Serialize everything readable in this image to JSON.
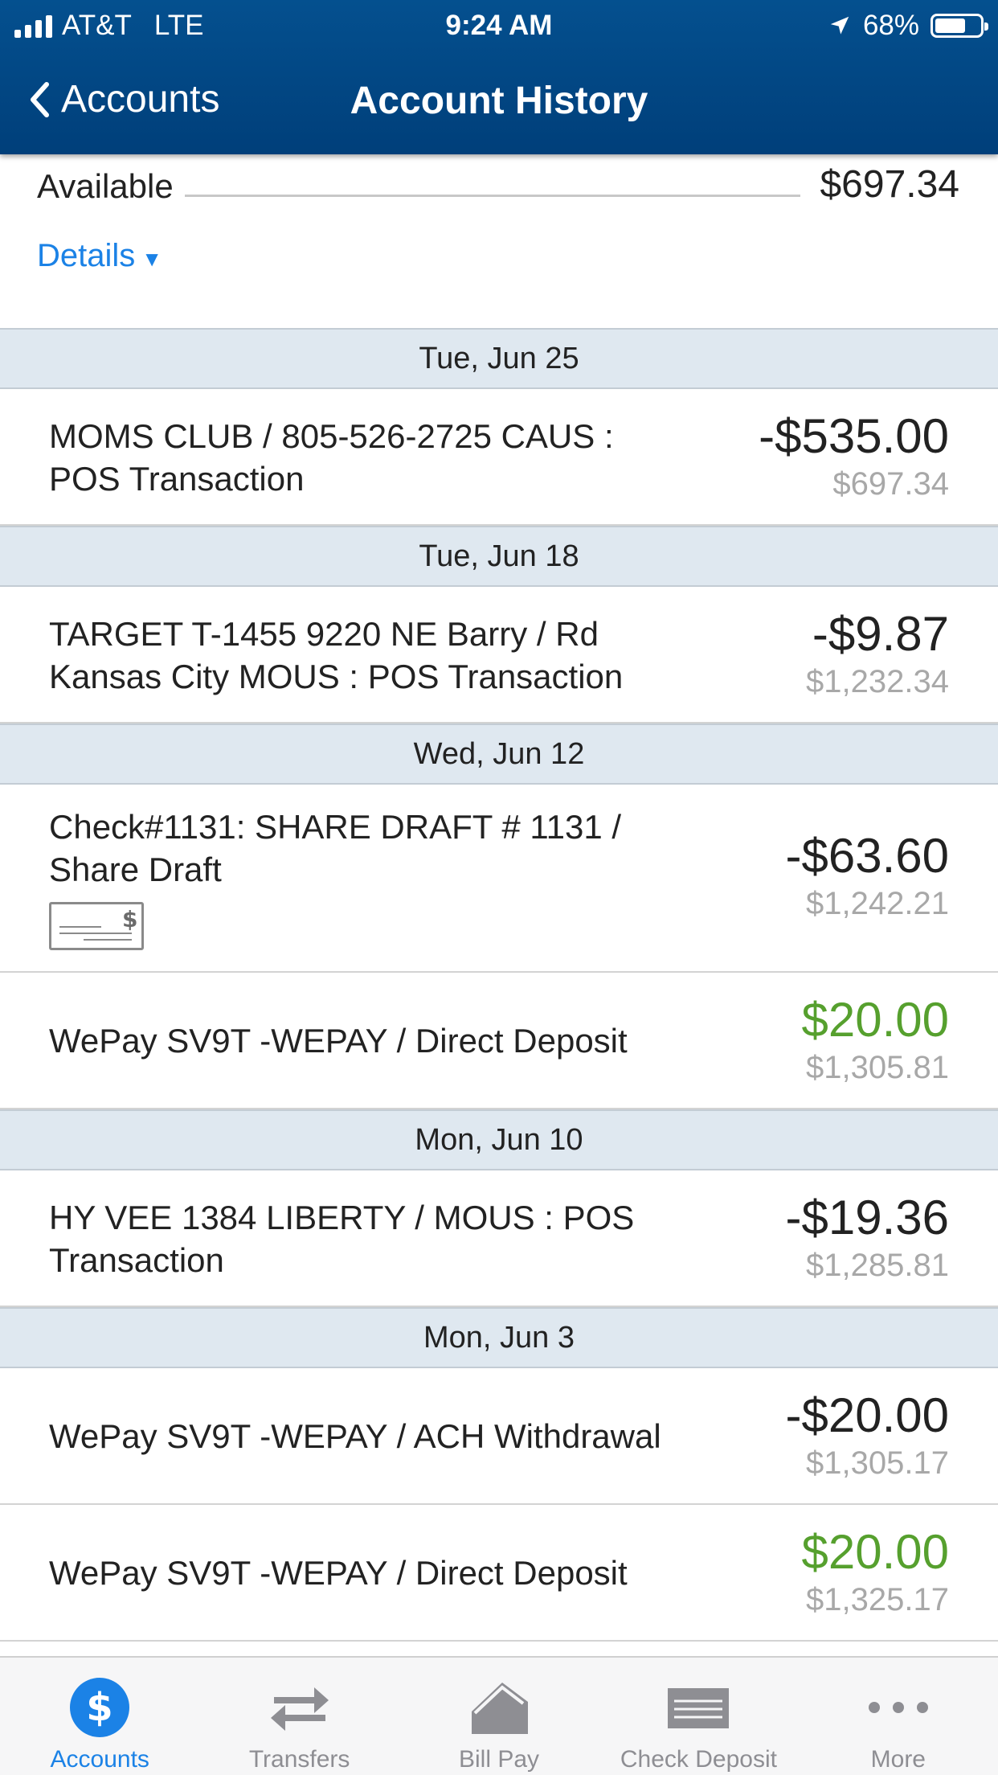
{
  "status_bar": {
    "carrier": "AT&T",
    "network": "LTE",
    "time": "9:24 AM",
    "battery": "68%"
  },
  "nav": {
    "back_label": "Accounts",
    "title": "Account History"
  },
  "account": {
    "available_label": "Available",
    "available_value": "$697.34",
    "details_label": "Details"
  },
  "dates": {
    "d0": "Tue, Jun 25",
    "d1": "Tue, Jun 18",
    "d2": "Wed, Jun 12",
    "d3": "Mon, Jun 10",
    "d4": "Mon, Jun 3"
  },
  "transactions": [
    {
      "line1": "MOMS CLUB / 805-526-2725 CAUS :",
      "line2": "POS Transaction",
      "amount": "-$535.00",
      "balance": "$697.34"
    },
    {
      "line1": "TARGET T-1455 9220 NE Barry / Rd",
      "line2": "Kansas City MOUS : POS Transaction",
      "amount": "-$9.87",
      "balance": "$1,232.34"
    },
    {
      "line1": "Check#1131: SHARE DRAFT # 1131 /",
      "line2": "Share Draft",
      "amount": "-$63.60",
      "balance": "$1,242.21"
    },
    {
      "line1": "WePay SV9T -WEPAY / Direct Deposit",
      "line2": "",
      "amount": "$20.00",
      "balance": "$1,305.81"
    },
    {
      "line1": "HY VEE 1384 LIBERTY / MOUS : POS",
      "line2": "Transaction",
      "amount": "-$19.36",
      "balance": "$1,285.81"
    },
    {
      "line1": "WePay SV9T -WEPAY / ACH Withdrawal",
      "line2": "",
      "amount": "-$20.00",
      "balance": "$1,305.17"
    },
    {
      "line1": "WePay SV9T -WEPAY / Direct Deposit",
      "line2": "",
      "amount": "$20.00",
      "balance": "$1,325.17"
    }
  ],
  "tabs": {
    "accounts": "Accounts",
    "transfers": "Transfers",
    "bill_pay": "Bill Pay",
    "check_deposit": "Check Deposit",
    "more": "More"
  },
  "colors": {
    "header": "#04508f",
    "accent": "#1b82e6",
    "positive": "#56a02e",
    "balance": "#a8a8a8"
  }
}
